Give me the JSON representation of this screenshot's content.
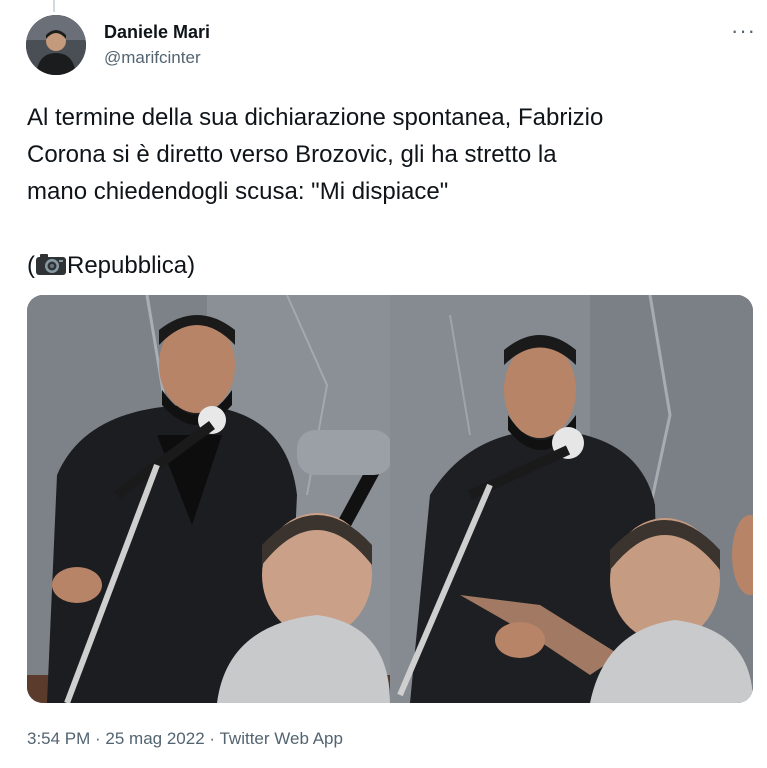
{
  "author": {
    "name": "Daniele Mari",
    "handle": "@marifcinter"
  },
  "tweet": {
    "lines": [
      "Al termine della sua dichiarazione spontanea, Fabrizio",
      "Corona si è diretto verso Brozovic, gli ha stretto la",
      "mano chiedendogli scusa: \"Mi dispiace\""
    ],
    "source_open": "(",
    "source_icon": "camera-icon",
    "source_text": "Repubblica)"
  },
  "media": {
    "description_icons": [
      "photo-left",
      "photo-right"
    ]
  },
  "footer": {
    "time": "3:54 PM",
    "sep1": " · ",
    "date": "25 mag 2022",
    "sep2": " · ",
    "app": "Twitter Web App"
  },
  "more_label": "···"
}
